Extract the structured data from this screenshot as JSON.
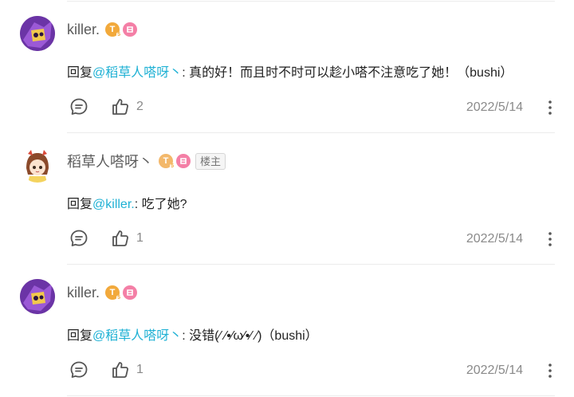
{
  "comments": [
    {
      "username": "killer.",
      "level": "T",
      "level_sub": "5",
      "is_owner": false,
      "reply_prefix": "回复",
      "mention": "@稻草人嗒呀丶",
      "text": ": 真的好！而且时不时可以趁小嗒不注意吃了她！（bushi）",
      "likes": "2",
      "date": "2022/5/14"
    },
    {
      "username": "稻草人嗒呀丶",
      "level": "T",
      "level_sub": "5",
      "is_owner": true,
      "owner_label": "楼主",
      "reply_prefix": "回复",
      "mention": "@killer.",
      "text": ": 吃了她?",
      "likes": "1",
      "date": "2022/5/14"
    },
    {
      "username": "killer.",
      "level": "T",
      "level_sub": "5",
      "is_owner": false,
      "reply_prefix": "回复",
      "mention": "@稻草人嗒呀丶",
      "text": ": 没错(⁄ ⁄•⁄ω⁄•⁄ ⁄)（bushi）",
      "likes": "1",
      "date": "2022/5/14"
    }
  ],
  "colors": {
    "mention": "#1fb1d4",
    "level_badge": "#f2a93b",
    "pink_badge": "#f47fa6"
  },
  "icons": {
    "reply": "chat-bubble-icon",
    "like": "thumbs-up-icon",
    "more": "vertical-dots-icon"
  }
}
